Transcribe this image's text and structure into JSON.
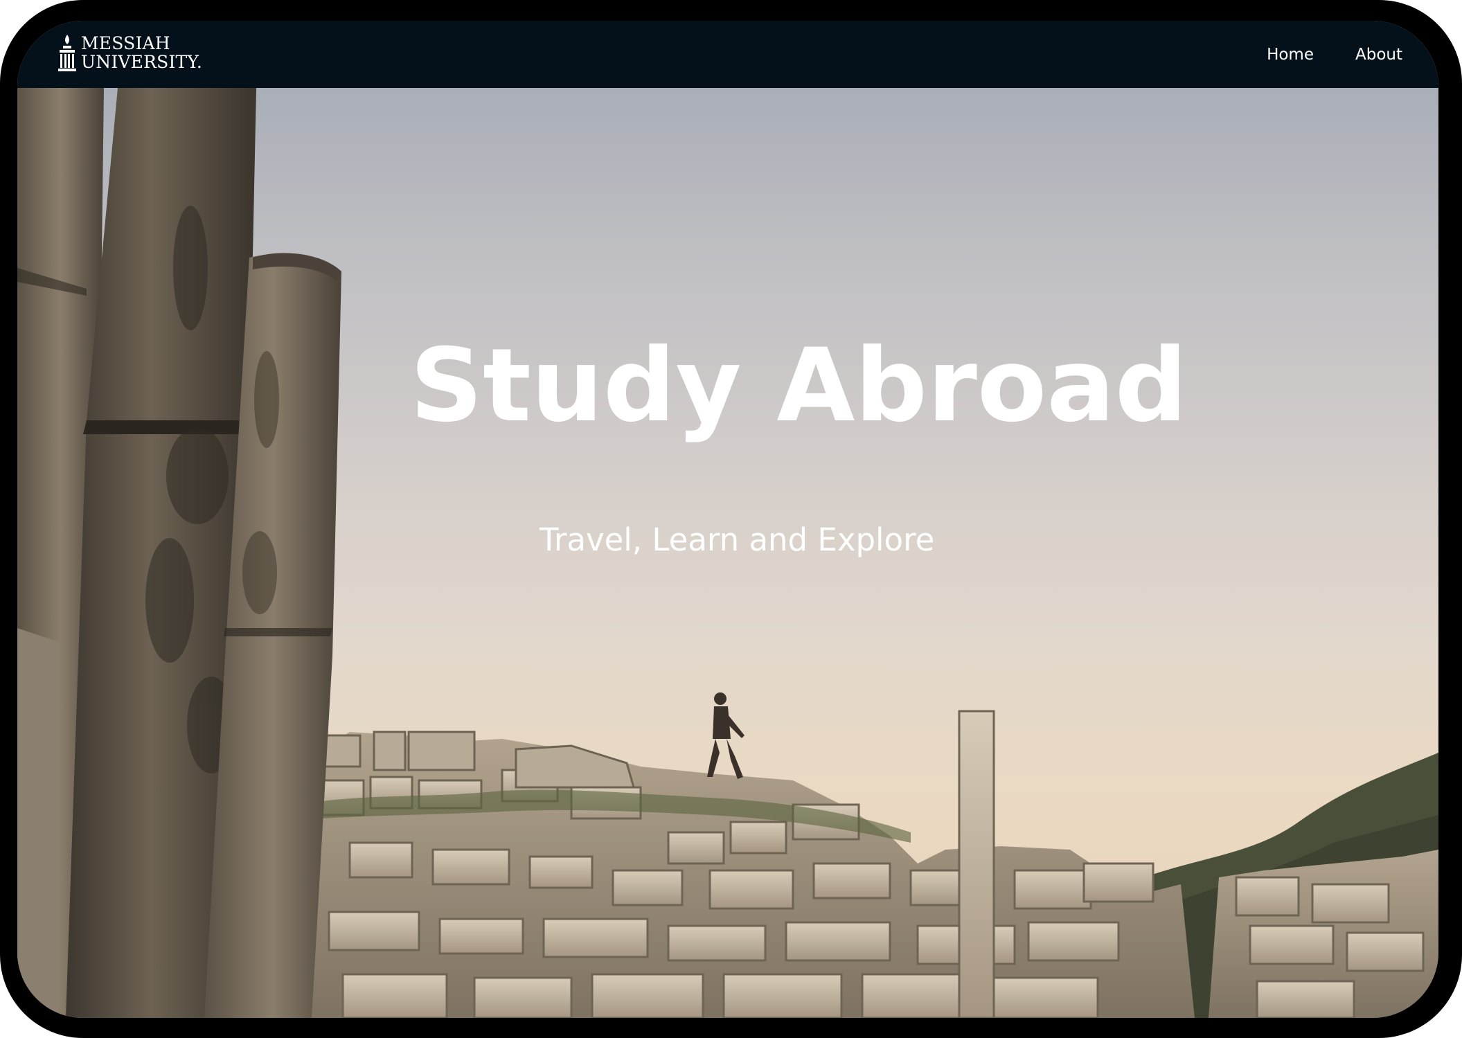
{
  "brand": {
    "logo_line1": "MESSIAH",
    "logo_line2": "UNIVERSITY.",
    "logo_icon": "lamp-building-icon"
  },
  "nav": {
    "items": [
      {
        "label": "Home"
      },
      {
        "label": "About"
      }
    ],
    "background_color": "#04111b"
  },
  "hero": {
    "title": "Study Abroad",
    "subtitle": "Travel, Learn and Explore"
  }
}
